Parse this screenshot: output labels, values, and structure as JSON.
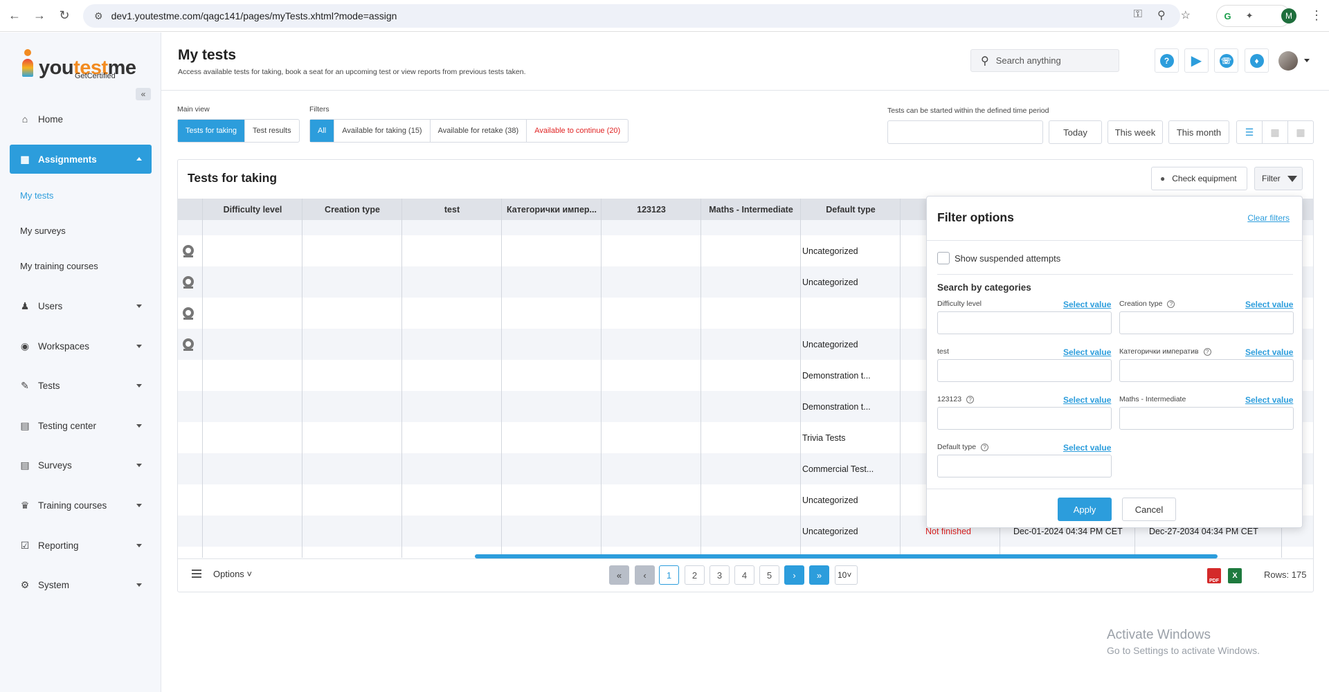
{
  "browser": {
    "url": "dev1.youtestme.com/qagc141/pages/myTests.xhtml?mode=assign",
    "profile_initial": "M"
  },
  "logo": {
    "part1": "you",
    "part2": "test",
    "part3": "me",
    "sub": "GetCertified"
  },
  "sidebar": {
    "items": [
      {
        "label": "Home",
        "icon": "home-icon"
      },
      {
        "label": "Assignments",
        "icon": "assignments-icon"
      },
      {
        "label": "Users",
        "icon": "users-icon"
      },
      {
        "label": "Workspaces",
        "icon": "workspaces-icon"
      },
      {
        "label": "Tests",
        "icon": "tests-icon"
      },
      {
        "label": "Testing center",
        "icon": "testing-center-icon"
      },
      {
        "label": "Surveys",
        "icon": "surveys-icon"
      },
      {
        "label": "Training courses",
        "icon": "trophy-icon"
      },
      {
        "label": "Reporting",
        "icon": "reporting-icon"
      },
      {
        "label": "System",
        "icon": "gear-icon"
      }
    ],
    "sub_items": [
      "My tests",
      "My surveys",
      "My training courses"
    ]
  },
  "header": {
    "title": "My tests",
    "subtitle": "Access available tests for taking, book a seat for an upcoming test or view reports from previous tests taken.",
    "search_placeholder": "Search anything"
  },
  "toolbar": {
    "main_view_label": "Main view",
    "main_view": [
      "Tests for taking",
      "Test results"
    ],
    "filters_label": "Filters",
    "filters": [
      "All",
      "Available for taking (15)",
      "Available for retake (38)",
      "Available to continue (20)"
    ],
    "period_label": "Tests can be started within the defined time period",
    "period_buttons": [
      "Today",
      "This week",
      "This month"
    ]
  },
  "panel": {
    "title": "Tests for taking",
    "check_equipment": "Check equipment",
    "filter": "Filter"
  },
  "table": {
    "columns": [
      "Difficulty level",
      "Creation type",
      "test",
      "Категорички импер...",
      "123123",
      "Maths - Intermediate",
      "Default type"
    ],
    "default_type_values": [
      "Uncategorized",
      "Uncategorized",
      "",
      "Uncategorized",
      "Demonstration t...",
      "Demonstration t...",
      "Trivia Tests",
      "Commercial Test...",
      "Uncategorized",
      "Uncategorized"
    ],
    "last_row": {
      "status": "Not finished",
      "start": "Dec-01-2024 04:34 PM CET",
      "end": "Dec-27-2034 04:34 PM CET"
    }
  },
  "footer": {
    "options": "Options",
    "pages": [
      "1",
      "2",
      "3",
      "4",
      "5"
    ],
    "page_size": "10",
    "rows": "Rows: 175",
    "pdf": "PDF",
    "xls": "X"
  },
  "filter_panel": {
    "title": "Filter options",
    "clear": "Clear filters",
    "suspended": "Show suspended attempts",
    "search_by": "Search by categories",
    "select_value": "Select value",
    "fields": [
      "Difficulty level",
      "Creation type",
      "test",
      "Категорички императив",
      "123123",
      "Maths - Intermediate",
      "Default type"
    ],
    "apply": "Apply",
    "cancel": "Cancel"
  },
  "watermark": {
    "line1": "Activate Windows",
    "line2": "Go to Settings to activate Windows."
  },
  "colors": {
    "accent": "#2c9ddc",
    "danger": "#e02424"
  }
}
